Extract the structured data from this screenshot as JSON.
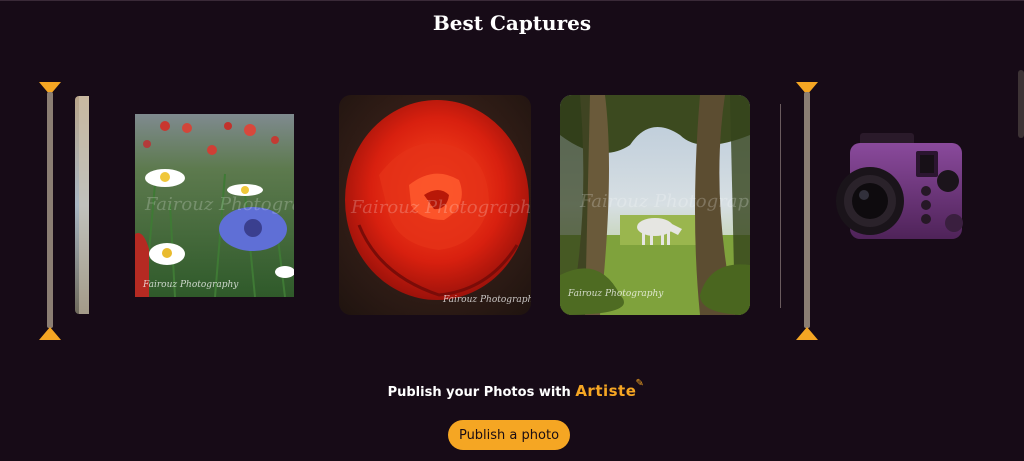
{
  "section": {
    "title": "Best Captures"
  },
  "gallery": {
    "watermark": "Fairouz Photography",
    "photos": [
      {
        "subject": "partial-left"
      },
      {
        "subject": "wildflowers"
      },
      {
        "subject": "red-rose"
      },
      {
        "subject": "white-horse-in-forest"
      }
    ]
  },
  "promo": {
    "text": "Publish your Photos with",
    "brand": "Artiste",
    "button_label": "Publish a photo"
  },
  "colors": {
    "background": "#170b17",
    "accent": "#f5a623",
    "strip": "#8b7e73",
    "camera": "#6b2f7a"
  },
  "icons": {
    "pen": "pencil-icon",
    "camera": "camera-icon"
  }
}
